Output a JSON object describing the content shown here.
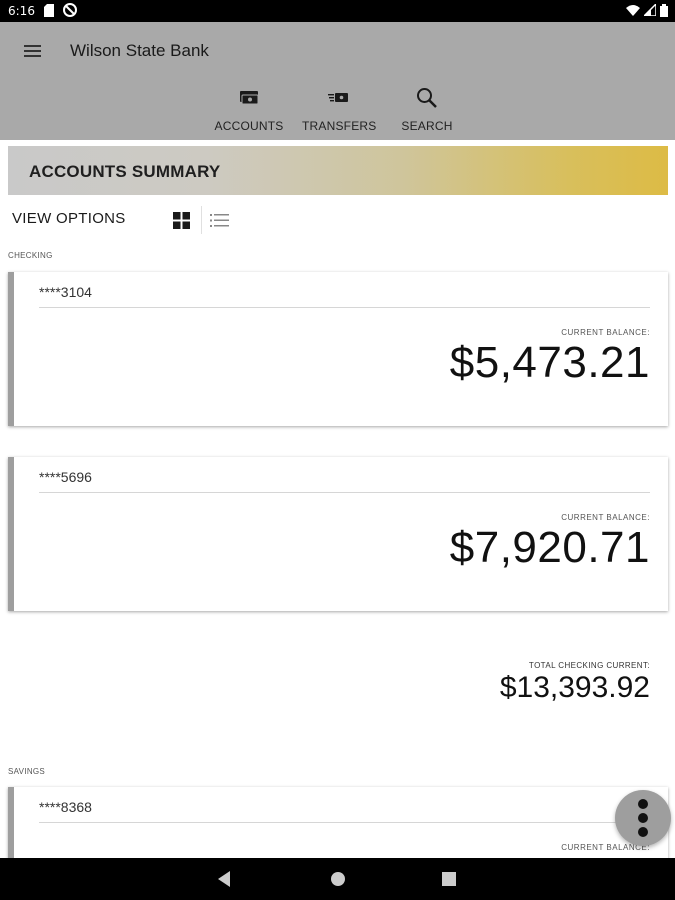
{
  "status_bar": {
    "time": "6:16",
    "left_icons": [
      "sd-card-icon",
      "do-not-disturb-icon"
    ],
    "right_icons": [
      "wifi-icon",
      "cell-signal-icon",
      "battery-icon"
    ]
  },
  "app_bar": {
    "title": "Wilson State Bank",
    "menu_icon": "hamburger-menu-icon",
    "nav": [
      {
        "label": "ACCOUNTS",
        "icon": "accounts-icon"
      },
      {
        "label": "TRANSFERS",
        "icon": "transfers-icon"
      },
      {
        "label": "SEARCH",
        "icon": "search-icon"
      }
    ],
    "background": "#a9a9a9"
  },
  "summary": {
    "title": "ACCOUNTS SUMMARY",
    "accent_color": "#ddbb45"
  },
  "view_options": {
    "label": "VIEW OPTIONS",
    "grid_icon": "grid-view-icon",
    "list_icon": "list-view-icon"
  },
  "checking": {
    "section_label": "CHECKING",
    "accounts": [
      {
        "number": "****3104",
        "balance_label": "CURRENT BALANCE:",
        "balance": "$5,473.21"
      },
      {
        "number": "****5696",
        "balance_label": "CURRENT BALANCE:",
        "balance": "$7,920.71"
      }
    ],
    "total_label": "TOTAL CHECKING CURRENT:",
    "total": "$13,393.92"
  },
  "savings": {
    "section_label": "SAVINGS",
    "accounts": [
      {
        "number": "****8368",
        "balance_label": "CURRENT BALANCE:"
      }
    ]
  },
  "fab": {
    "icon": "more-vert-icon"
  },
  "system_nav": {
    "back_icon": "back-icon",
    "home_icon": "home-icon",
    "recents_icon": "recents-icon"
  }
}
